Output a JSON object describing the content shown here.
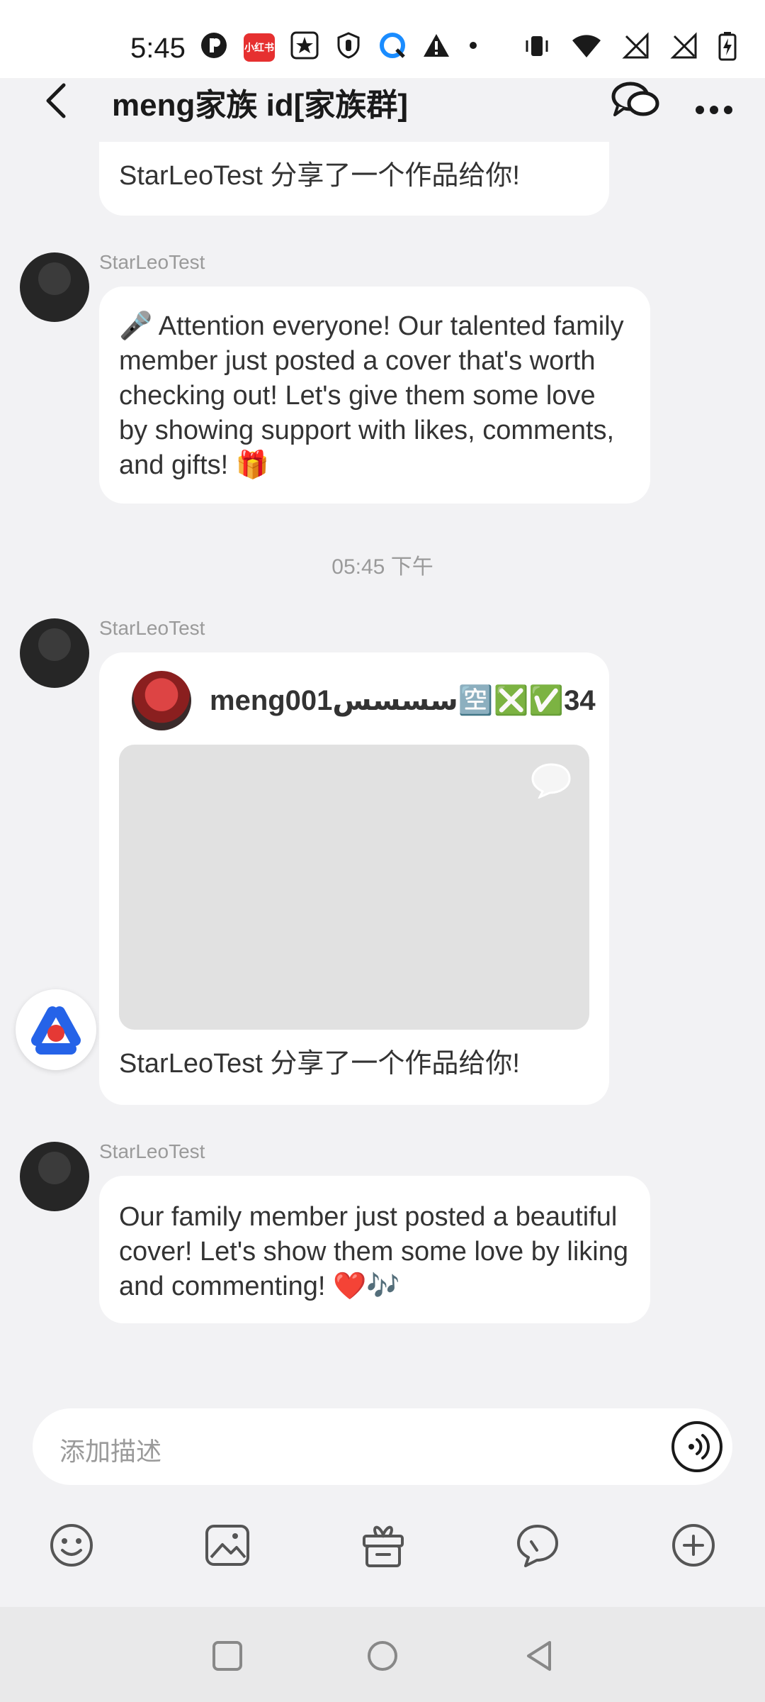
{
  "status_bar": {
    "time": "5:45",
    "left_icons": [
      "app-p-icon",
      "app-red-badge-icon",
      "star-badge-icon",
      "shield-icon",
      "blue-q-icon",
      "warning-icon",
      "dot-icon"
    ],
    "right_icons": [
      "vibrate-icon",
      "wifi-icon",
      "no-signal-1-icon",
      "no-signal-2-icon",
      "battery-charging-icon"
    ],
    "red_badge_text": "小红书"
  },
  "header": {
    "title": "meng家族 id[家族群]"
  },
  "messages": [
    {
      "type": "share_tail",
      "text": "StarLeoTest 分享了一个作品给你!"
    },
    {
      "type": "text",
      "sender": "StarLeoTest",
      "text": "🎤 Attention everyone! Our talented family member just posted a cover that's worth checking out! Let's give them some love by showing support with likes, comments, and gifts! 🎁"
    },
    {
      "type": "timestamp",
      "text": "05:45 下午"
    },
    {
      "type": "share_card",
      "sender": "StarLeoTest",
      "card_author": "meng001سسسس🈳❎✅34",
      "caption": "StarLeoTest 分享了一个作品给你!"
    },
    {
      "type": "text",
      "sender": "StarLeoTest",
      "text": "Our family member just posted a beautiful cover! Let's show them some love by liking and commenting! ❤️🎶"
    }
  ],
  "composer": {
    "placeholder": "添加描述"
  },
  "toolbar": [
    "emoji-icon",
    "image-icon",
    "gift-icon",
    "chat-bubble-icon",
    "add-icon"
  ],
  "navbar": [
    "recent-apps-icon",
    "home-icon",
    "back-nav-icon"
  ]
}
